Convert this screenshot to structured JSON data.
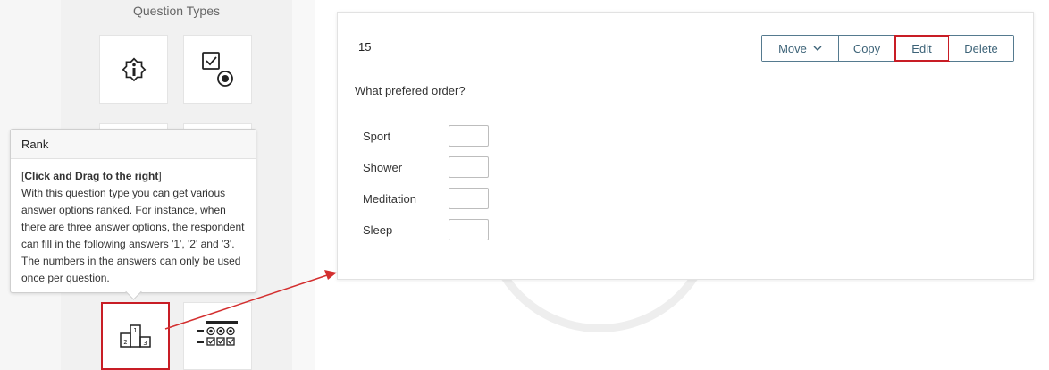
{
  "sidebar": {
    "title": "Question Types",
    "tiles": [
      {
        "icon": "info-icon"
      },
      {
        "icon": "checkbox-radio-icon"
      },
      {
        "icon": "rank-podium-icon"
      },
      {
        "icon": "matrix-icon"
      }
    ]
  },
  "tooltip": {
    "title": "Rank",
    "bracket_open": "[",
    "bold_text": "Click and Drag to the right",
    "bracket_close": "]",
    "description": "With this question type you can get various answer options ranked. For instance, when there are three answer options, the respondent can fill in the following answers '1', '2' and '3'. The numbers in the answers can only be used once per question."
  },
  "podium_icon": {
    "first": "1",
    "second": "2",
    "third": "3"
  },
  "question": {
    "number": "15",
    "text": "What prefered order?",
    "options": [
      "Sport",
      "Shower",
      "Meditation",
      "Sleep"
    ]
  },
  "toolbar": {
    "move_label": "Move",
    "copy_label": "Copy",
    "edit_label": "Edit",
    "delete_label": "Delete"
  },
  "colors": {
    "highlight": "#c81d25",
    "button_text": "#3d6378",
    "button_border": "#557a8f"
  }
}
